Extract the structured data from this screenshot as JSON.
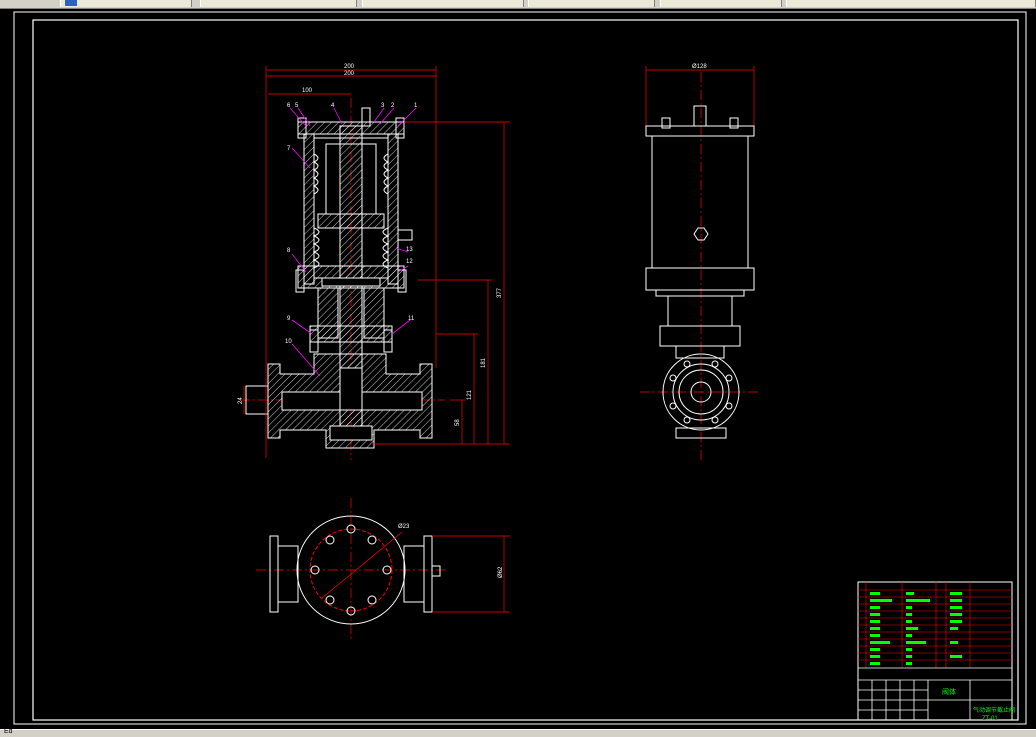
{
  "window": {
    "tabs": [
      {
        "label": ""
      },
      {
        "label": ""
      },
      {
        "label": ""
      },
      {
        "label": ""
      },
      {
        "label": ""
      },
      {
        "label": ""
      }
    ],
    "status_text": "Ed"
  },
  "drawing": {
    "front_view": {
      "dim_top_1": "200",
      "dim_top_2": "200",
      "dim_left": "100",
      "dim_height_total": "377",
      "dim_height_2": "181",
      "dim_height_3": "121",
      "dim_height_4": "58",
      "dim_port": "24",
      "part_numbers": [
        "1",
        "2",
        "3",
        "4",
        "5",
        "6",
        "7",
        "8",
        "9",
        "10",
        "11",
        "12",
        "13"
      ]
    },
    "side_view": {
      "dim_width": "Ø128"
    },
    "top_view": {
      "dim_circle": "Ø23",
      "dim_height": "Ø62"
    },
    "title_block": {
      "title_cn": "阀体",
      "drawing_name": "气动调节截止阀",
      "drawing_no": "ZT-01"
    }
  },
  "colors": {
    "background": "#000000",
    "outline": "#ffffff",
    "hatch": "#ffffff",
    "dimension": "#ff0000",
    "center": "#ff0000",
    "leader": "#ff00ff",
    "text": "#00ff00"
  }
}
